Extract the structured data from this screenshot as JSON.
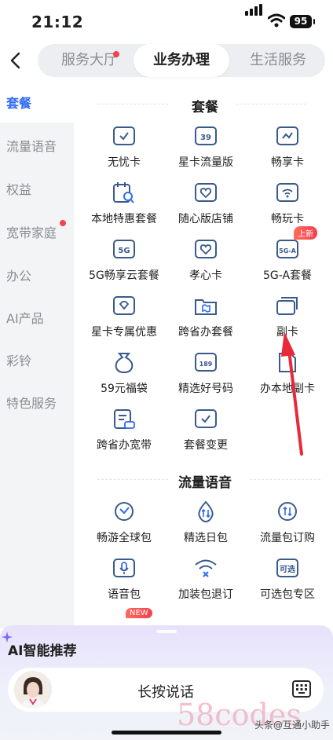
{
  "status": {
    "time": "21:12",
    "battery": "95"
  },
  "top_tabs": [
    {
      "label": "服务大厅",
      "dot": true
    },
    {
      "label": "业务办理",
      "active": true
    },
    {
      "label": "生活服务"
    }
  ],
  "sidebar": {
    "items": [
      {
        "label": "套餐",
        "active": true
      },
      {
        "label": "流量语音"
      },
      {
        "label": "权益"
      },
      {
        "label": "宽带家庭",
        "dot": true
      },
      {
        "label": "办公"
      },
      {
        "label": "AI产品"
      },
      {
        "label": "彩铃"
      },
      {
        "label": "特色服务"
      }
    ]
  },
  "sections": [
    {
      "title": "套餐",
      "items": [
        {
          "label": "无忧卡",
          "icon": "card-check-icon"
        },
        {
          "label": "星卡流量版",
          "icon": "card-39-icon",
          "icon_text": "39"
        },
        {
          "label": "畅享卡",
          "icon": "card-wave-icon"
        },
        {
          "label": "本地特惠套餐",
          "icon": "calendar-search-icon"
        },
        {
          "label": "随心版店铺",
          "icon": "heart-card-icon"
        },
        {
          "label": "畅玩卡",
          "icon": "wifi-card-icon"
        },
        {
          "label": "5G畅享云套餐",
          "icon": "card-5g-icon",
          "icon_text": "5G"
        },
        {
          "label": "孝心卡",
          "icon": "heart-card-icon"
        },
        {
          "label": "5G-A套餐",
          "icon": "card-5ga-icon",
          "icon_text": "5G-A",
          "badge": "上新"
        },
        {
          "label": "星卡专属优惠",
          "icon": "diamond-ticket-icon"
        },
        {
          "label": "跨省办套餐",
          "icon": "folder-map-icon"
        },
        {
          "label": "副卡",
          "icon": "double-card-icon"
        },
        {
          "label": "59元福袋",
          "icon": "money-bag-icon",
          "icon_text": "59"
        },
        {
          "label": "精选好号码",
          "icon": "calendar-189-icon",
          "icon_text": "189"
        },
        {
          "label": "办本地副卡",
          "icon": "sim-card-icon"
        },
        {
          "label": "跨省办宽带",
          "icon": "clipboard-broadband-icon"
        },
        {
          "label": "套餐变更",
          "icon": "card-check-icon"
        }
      ]
    },
    {
      "title": "流量语音",
      "items": [
        {
          "label": "畅游全球包",
          "icon": "globe-arrow-icon"
        },
        {
          "label": "精选日包",
          "icon": "drop-arrows-icon"
        },
        {
          "label": "流量包订购",
          "icon": "circle-arrows-icon"
        },
        {
          "label": "语音包",
          "icon": "microphone-card-icon"
        },
        {
          "label": "加装包退订",
          "icon": "wifi-cross-icon"
        },
        {
          "label": "可选包专区",
          "icon": "tag-optional-icon",
          "icon_text": "可选"
        }
      ]
    }
  ],
  "extra_badge": "NEW",
  "ai_panel": {
    "title": "AI智能推荐",
    "talk_label": "长按说话"
  },
  "watermark": {
    "big": "58codes",
    "small": "头条@互通小助手"
  },
  "colors": {
    "accent": "#2f6bf2",
    "icon": "#3a5a8c",
    "red": "#e8293a"
  }
}
